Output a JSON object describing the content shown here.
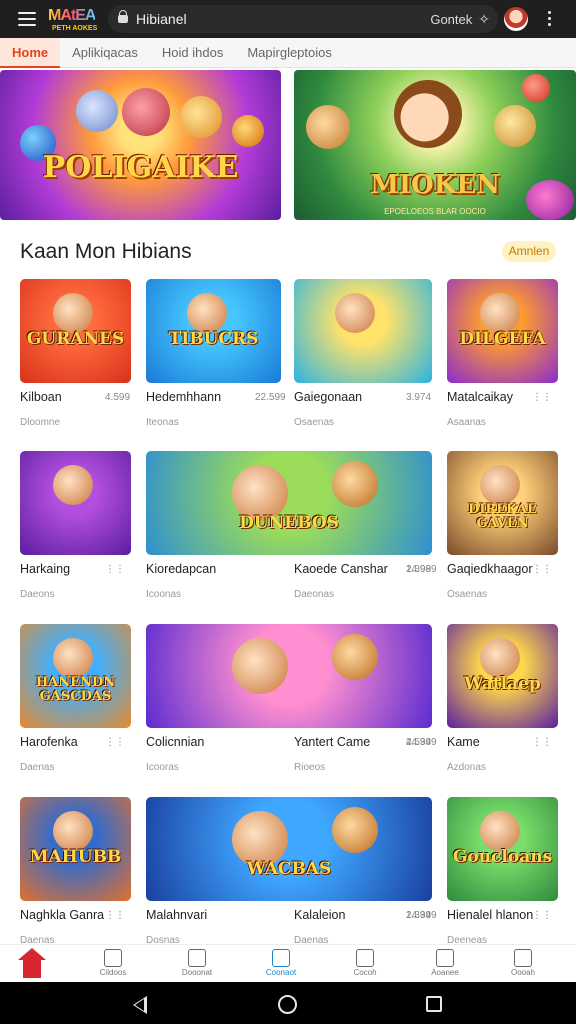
{
  "browser": {
    "url": "Hibianel",
    "right_label": "Gontek"
  },
  "tabs": [
    "Home",
    "Aplikiqacas",
    "Hoid ihdos",
    "Mapirgleptoios"
  ],
  "banners": [
    {
      "title": "POLIGAIKE",
      "subtitle": ""
    },
    {
      "title": "MIOKEN",
      "subtitle": "EPOELOEOS BLAR OOCIO"
    }
  ],
  "section": {
    "title": "Kaan Mon Hibians",
    "more_label": "Amnlen"
  },
  "games": [
    {
      "name": "Kilboan",
      "count": "4.599",
      "sub": "Dloomne",
      "art": "GURANES",
      "bg": [
        "#ff6b3d",
        "#d8321b"
      ]
    },
    {
      "name": "Hedemhhann",
      "count": "22.599",
      "sub": "Iteonas",
      "art": "TIBUCRS",
      "bg": [
        "#46c6ff",
        "#1a7ad6"
      ]
    },
    {
      "name": "Gaiegonaan",
      "count": "3.974",
      "sub": "Osaenas",
      "art": "",
      "bg": [
        "#ffe36a",
        "#2bb3e0"
      ]
    },
    {
      "name": "Matalcaikay",
      "count": "",
      "sub": "Asaanas",
      "art": "DILGEFA",
      "bg": [
        "#ff9b2f",
        "#8a2bd0"
      ]
    },
    {
      "name": "Harkaing",
      "count": "",
      "sub": "Daeons",
      "art": "",
      "bg": [
        "#b34fe0",
        "#5a1ea0"
      ]
    },
    {
      "name": "Kioredapcan",
      "count": "24.999",
      "sub": "Icoonas",
      "art": "DUNEBOS",
      "bg": [
        "#9bdc5a",
        "#2e8fd0"
      ]
    },
    {
      "name": "Kaoede Canshar",
      "count": "1.398",
      "sub": "Daeonas",
      "art": "",
      "bg": [
        "#ffb347",
        "#b34fe0"
      ]
    },
    {
      "name": "Gaqiedkhaagor",
      "count": "",
      "sub": "Osaenas",
      "art": "DIREKAE GAVEN",
      "bg": [
        "#ffd27a",
        "#7a4a2a"
      ]
    },
    {
      "name": "Harofenka",
      "count": "",
      "sub": "Daenas",
      "art": "HANENDN GASCDAS",
      "bg": [
        "#3fb0ff",
        "#e68a2e"
      ]
    },
    {
      "name": "Colicnnian",
      "count": "44.399",
      "sub": "Icooras",
      "art": "",
      "bg": [
        "#ff8fd0",
        "#5a2bd0"
      ]
    },
    {
      "name": "Yantert Came",
      "count": "2.594",
      "sub": "Rioeos",
      "art": "",
      "bg": [
        "#8fe0ff",
        "#ff9a3c"
      ]
    },
    {
      "name": "Kame",
      "count": "",
      "sub": "Azdonas",
      "art": "Watlaep",
      "bg": [
        "#ffd84a",
        "#5a1ea0"
      ]
    },
    {
      "name": "Naghkla Ganra",
      "count": "",
      "sub": "Daenas",
      "art": "MAHUBB",
      "bg": [
        "#2f6bd0",
        "#e0702e"
      ]
    },
    {
      "name": "Malahnvari",
      "count": "24.999",
      "sub": "Dosnas",
      "art": "WACBAS",
      "bg": [
        "#3fa7ff",
        "#1a3fa0"
      ]
    },
    {
      "name": "Kalaleion",
      "count": "1.334",
      "sub": "Daenas",
      "art": "",
      "bg": [
        "#ffb347",
        "#2e8fd0"
      ]
    },
    {
      "name": "Hienalel hlanon",
      "count": "",
      "sub": "Deeneas",
      "art": "Goucloans",
      "bg": [
        "#7adf6a",
        "#2f8a3e"
      ]
    }
  ],
  "bottom_nav": [
    "Cildoos",
    "Dooonat",
    "Coonaot",
    "Cocoh",
    "Aoanee",
    "Oooah"
  ],
  "colors": {
    "accent": "#e8421f",
    "nav_active": "#1e88c7",
    "home": "#d7262f"
  }
}
